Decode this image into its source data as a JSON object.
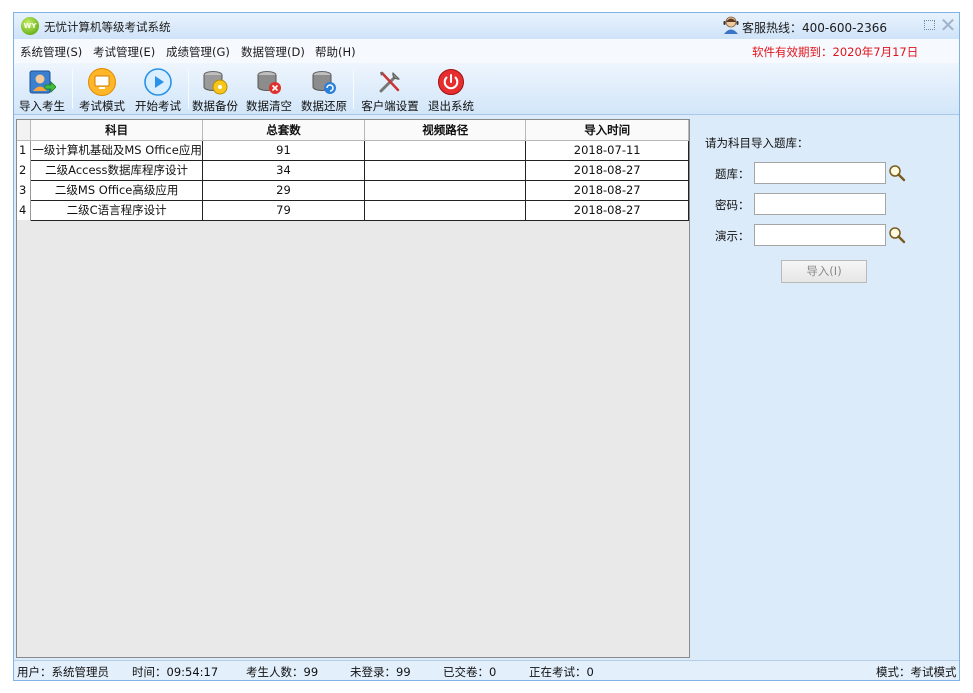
{
  "window": {
    "title": "无忧计算机等级考试系统",
    "logo_text": "WY",
    "hotline": "客服热线：400-600-2366",
    "close_glyph": "✕"
  },
  "menu": {
    "items": [
      "系统管理(S)",
      "考试管理(E)",
      "成绩管理(G)",
      "数据管理(D)",
      "帮助(H)"
    ],
    "expiry": "软件有效期到：2020年7月17日"
  },
  "toolbar": {
    "items": [
      {
        "label": "导入考生",
        "icon": "import-students-icon"
      },
      {
        "label": "考试模式",
        "icon": "exam-mode-icon"
      },
      {
        "label": "开始考试",
        "icon": "start-exam-icon"
      },
      {
        "label": "数据备份",
        "icon": "data-backup-icon"
      },
      {
        "label": "数据清空",
        "icon": "data-clear-icon"
      },
      {
        "label": "数据还原",
        "icon": "data-restore-icon"
      },
      {
        "label": "客户端设置",
        "icon": "client-settings-icon"
      },
      {
        "label": "退出系统",
        "icon": "exit-system-icon"
      }
    ]
  },
  "grid": {
    "columns": [
      "科目",
      "总套数",
      "视频路径",
      "导入时间"
    ],
    "rows": [
      {
        "index": "1",
        "subject": "一级计算机基础及MS Office应用",
        "count": "91",
        "video": "",
        "time": "2018-07-11"
      },
      {
        "index": "2",
        "subject": "二级Access数据库程序设计",
        "count": "34",
        "video": "",
        "time": "2018-08-27"
      },
      {
        "index": "3",
        "subject": "二级MS Office高级应用",
        "count": "29",
        "video": "",
        "time": "2018-08-27"
      },
      {
        "index": "4",
        "subject": "二级C语言程序设计",
        "count": "79",
        "video": "",
        "time": "2018-08-27"
      }
    ]
  },
  "import_panel": {
    "title": "请为科目导入题库：",
    "bank_label": "题库：",
    "bank_value": "",
    "password_label": "密码：",
    "password_value": "",
    "demo_label": "演示：",
    "demo_value": "",
    "import_button": "导入(I)"
  },
  "status": {
    "user": "用户：系统管理员",
    "time": "时间：09:54:17",
    "students": "考生人数：99",
    "not_logged": "未登录：99",
    "submitted": "已交卷：0",
    "in_exam": "正在考试：0",
    "mode": "模式：考试模式"
  }
}
